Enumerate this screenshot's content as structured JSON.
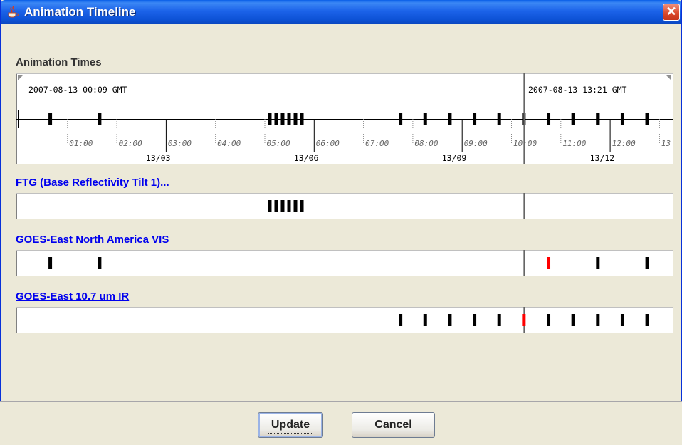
{
  "window": {
    "title": "Animation Timeline",
    "close_glyph": "✕"
  },
  "heading": "Animation Times",
  "timeline": {
    "start_label": "2007-08-13 00:09 GMT",
    "end_label": "2007-08-13 13:21 GMT",
    "hour_labels": [
      "01:00",
      "02:00",
      "03:00",
      "04:00",
      "05:00",
      "06:00",
      "07:00",
      "08:00",
      "09:00",
      "10:00",
      "11:00",
      "12:00",
      "13"
    ],
    "date_labels": [
      "13/03",
      "13/06",
      "13/09",
      "13/12"
    ],
    "current_time_hours": 10.2
  },
  "tracks": [
    {
      "label": "FTG (Base Reflectivity Tilt 1)...",
      "times": [
        5.05,
        5.18,
        5.31,
        5.44,
        5.57,
        5.7
      ]
    },
    {
      "label": "GOES-East North America VIS",
      "times": [
        0.6,
        1.6,
        10.7,
        11.7,
        12.7
      ]
    },
    {
      "label": "GOES-East 10.7 um IR",
      "times": [
        7.7,
        8.2,
        8.7,
        9.2,
        9.7,
        10.2,
        10.7,
        11.2,
        11.7,
        12.2,
        12.7
      ]
    }
  ],
  "selected_times": {
    "GOES-East North America VIS": 10.7,
    "GOES-East 10.7 um IR": 10.2
  },
  "buttons": {
    "update": "Update",
    "cancel": "Cancel"
  },
  "colors": {
    "titlebar": "#1c63e9",
    "link": "#0000ee",
    "selected_tick": "#ff0000"
  }
}
